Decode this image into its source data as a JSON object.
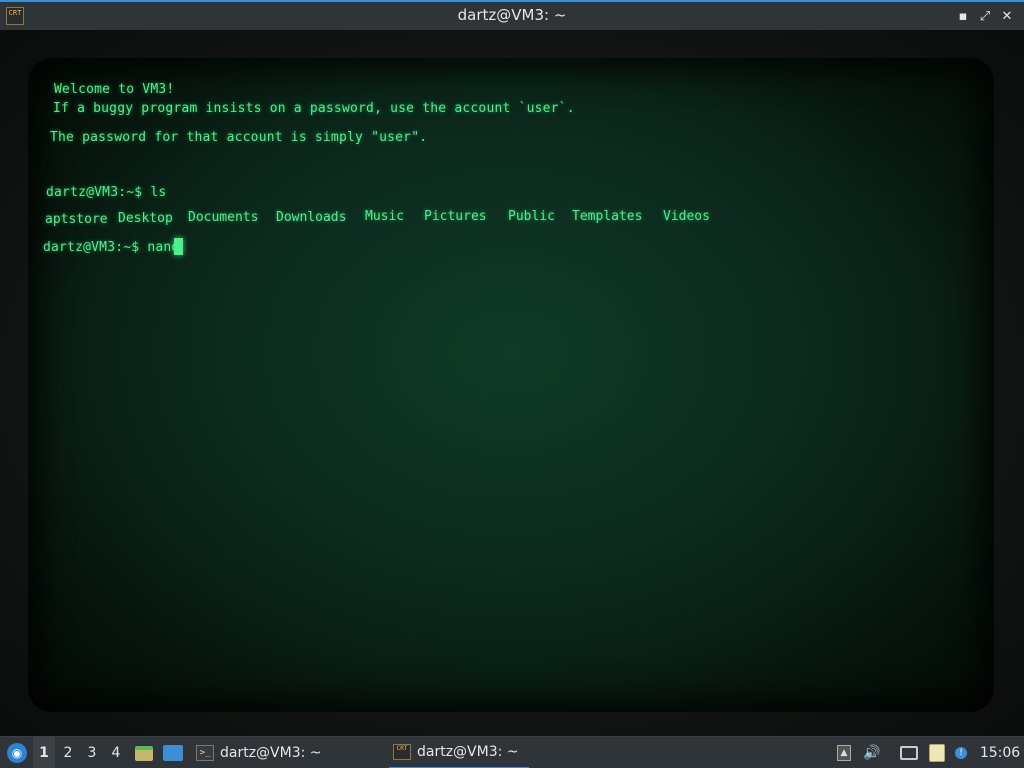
{
  "window": {
    "title": "dartz@VM3: ~",
    "app_icon_text": "CRT",
    "buttons": [
      "minimize",
      "maximize",
      "close"
    ]
  },
  "terminal": {
    "lines": [
      "Welcome to VM3!",
      "If a buggy program insists on a password, use the account `user`.",
      "The password for that account is simply \"user\"."
    ],
    "prompt1": "dartz@VM3:~$ ls",
    "ls_output": [
      "aptstore",
      "Desktop",
      "Documents",
      "Downloads",
      "Music",
      "Pictures",
      "Public",
      "Templates",
      "Videos"
    ],
    "prompt2": "dartz@VM3:~$ nano",
    "phosphor_color": "#4cf08a"
  },
  "taskbar": {
    "menu_icon": "distro-menu-icon",
    "workspaces": [
      "1",
      "2",
      "3",
      "4"
    ],
    "active_workspace": "1",
    "tasks": [
      {
        "label": "dartz@VM3: ~",
        "icon": "terminal-icon"
      },
      {
        "label": "dartz@VM3: ~",
        "icon": "crt-icon"
      }
    ],
    "tray": [
      "update-icon",
      "volume-icon",
      "network-icon",
      "clipboard-icon",
      "notification-icon"
    ],
    "clock": "15:06"
  },
  "colors": {
    "accent": "#3b8fd6",
    "panel": "#2f3438"
  }
}
